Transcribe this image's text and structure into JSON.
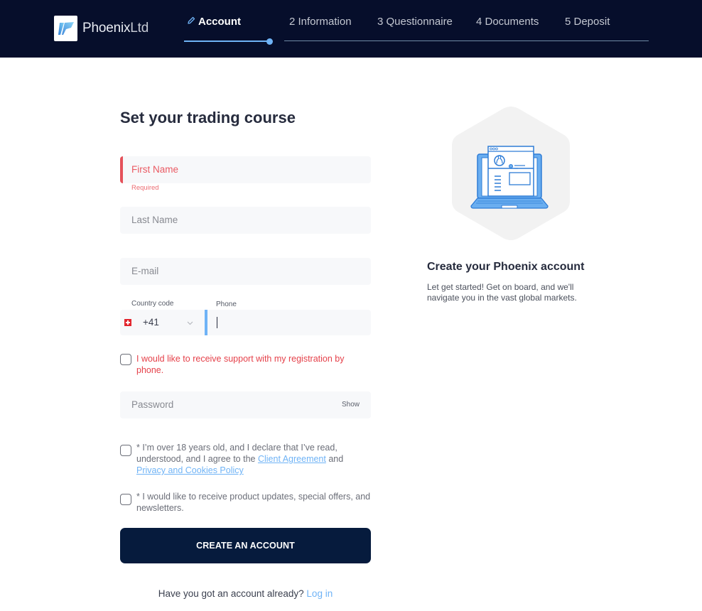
{
  "header": {
    "logo": {
      "brand": "Phoenix",
      "suffix": "Ltd",
      "icon": "phoenix-logo-icon"
    },
    "steps": [
      {
        "label": "Account",
        "number": "",
        "active": true,
        "icon": "pencil-icon"
      },
      {
        "label": "2 Information",
        "active": false
      },
      {
        "label": "3 Questionnaire",
        "active": false
      },
      {
        "label": "4 Documents",
        "active": false
      },
      {
        "label": "5 Deposit",
        "active": false
      }
    ],
    "colors": {
      "background": "#060e2b",
      "progress_active": "#6fb3f6"
    }
  },
  "form": {
    "title": "Set your trading course",
    "first_name": {
      "placeholder": "First Name",
      "value": "",
      "error": "Required"
    },
    "last_name": {
      "placeholder": "Last Name",
      "value": ""
    },
    "email": {
      "placeholder": "E-mail",
      "value": ""
    },
    "country_code": {
      "label": "Country code",
      "value": "+41",
      "flag": "switzerland-flag-icon"
    },
    "phone": {
      "label": "Phone",
      "value": ""
    },
    "phone_support_checkbox": {
      "label": "I would like to receive support with my registration by phone.",
      "checked": false
    },
    "password": {
      "placeholder": "Password",
      "value": "",
      "toggle_label": "Show"
    },
    "terms_checkbox": {
      "prefix": "* I’m over 18 years old, and I declare that I’ve read, understood, and I agree to the ",
      "link1": "Client Agreement",
      "middle": " and ",
      "link2": "Privacy and Cookies Policy",
      "checked": false
    },
    "newsletter_checkbox": {
      "label": "* I would like to receive product updates, special offers, and newsletters.",
      "checked": false
    },
    "submit_label": "CREATE AN ACCOUNT",
    "login_prompt": "Have you got an account already?",
    "login_link": "Log in",
    "colors": {
      "error": "#e5525a",
      "link": "#6fb3f6",
      "button": "#061b3d"
    }
  },
  "side": {
    "illustration": "laptop-profile-icon",
    "title": "Create your Phoenix account",
    "description": "Let get started! Get on board, and we'll navigate you in the vast global markets."
  }
}
